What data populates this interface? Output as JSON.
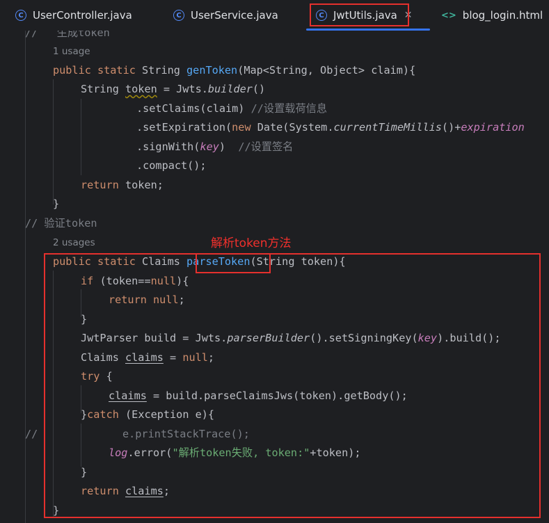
{
  "tabs": [
    {
      "label": "UserController.java",
      "icon": "class-icon"
    },
    {
      "label": "UserService.java",
      "icon": "class-icon"
    },
    {
      "label": "JwtUtils.java",
      "icon": "class-icon",
      "active": true
    },
    {
      "label": "blog_login.html",
      "icon": "html-icon"
    }
  ],
  "annotation": "解析token方法",
  "code": {
    "l0": "//   生成token",
    "l1_hint": "1 usage",
    "l2": [
      "public static ",
      "String ",
      "genToken",
      "(Map<String, Object> claim){"
    ],
    "l3": [
      "String ",
      "token",
      " = Jwts.",
      "builder",
      "()"
    ],
    "l4": [
      ".setClaims(claim) ",
      "//设置载荷信息"
    ],
    "l5": [
      ".setExpiration(",
      "new ",
      "Date(System.",
      "currentTimeMillis",
      "()+",
      "expiration"
    ],
    "l6": [
      ".signWith(",
      "key",
      ")  ",
      "//设置签名"
    ],
    "l7": ".compact();",
    "l8": [
      "return ",
      "token;"
    ],
    "l9": "}",
    "l10": "// 验证token",
    "l11_hint": "2 usages",
    "l12": [
      "public static ",
      "Claims ",
      "parseToken",
      "(String token){"
    ],
    "l13": [
      "if ",
      "(token==",
      "null",
      "){"
    ],
    "l14": [
      "return ",
      "null",
      ";"
    ],
    "l15": "}",
    "l16": [
      "JwtParser build = Jwts.",
      "parserBuilder",
      "().setSigningKey(",
      "key",
      ").build();"
    ],
    "l17": [
      "Claims ",
      "claims",
      " = ",
      "null",
      ";"
    ],
    "l18": [
      "try ",
      "{"
    ],
    "l19": [
      "claims",
      " = build.parseClaimsJws(token).getBody();"
    ],
    "l20": [
      "}",
      "catch ",
      "(Exception e){"
    ],
    "l21": [
      "//",
      "e.printStackTrace();"
    ],
    "l22": [
      "log",
      ".error(",
      "\"解析token失败, token:\"",
      "+token);"
    ],
    "l23": "}",
    "l24": [
      "return ",
      "claims",
      ";"
    ],
    "l25": "}"
  }
}
